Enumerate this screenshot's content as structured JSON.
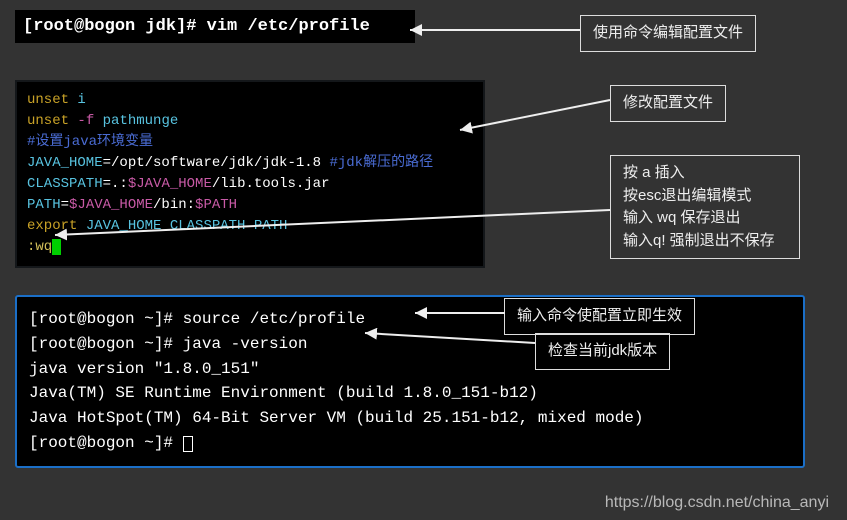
{
  "terminal1": {
    "prompt": "[root@bogon jdk]#",
    "command": "vim /etc/profile"
  },
  "terminal2": {
    "line1a": "unset",
    "line1b": "i",
    "line2a": "unset",
    "line2b": "-f",
    "line2c": "pathmunge",
    "line3a": "#设置java环境变量",
    "line4a": "JAVA_HOME",
    "line4b": "=/opt/software/jdk/jdk-1.8",
    "line4c": "#jdk解压的路径",
    "line5a": "CLASSPATH",
    "line5b": "=.:",
    "line5c": "$JAVA_HOME",
    "line5d": "/lib.tools.jar",
    "line6a": "PATH",
    "line6b": "=",
    "line6c": "$JAVA_HOME",
    "line6d": "/bin:",
    "line6e": "$PATH",
    "line7a": "export",
    "line7b": "JAVA_HOME CLASSPATH PATH",
    "line8a": ":wq"
  },
  "terminal3": {
    "prompt1": "[root@bogon ~]#",
    "cmd1": "source /etc/profile",
    "prompt2": "[root@bogon ~]#",
    "cmd2": "java -version",
    "out1": "java version \"1.8.0_151\"",
    "out2": "Java(TM) SE Runtime Environment (build 1.8.0_151-b12)",
    "out3": "Java HotSpot(TM) 64-Bit Server VM (build 25.151-b12, mixed mode)",
    "prompt3": "[root@bogon ~]#"
  },
  "annotations": {
    "a1": "使用命令编辑配置文件",
    "a2": "修改配置文件",
    "a3_l1": "按 a 插入",
    "a3_l2": "按esc退出编辑模式",
    "a3_l3": "输入 wq 保存退出",
    "a3_l4": "输入q! 强制退出不保存",
    "a4": "输入命令使配置立即生效",
    "a5": "检查当前jdk版本"
  },
  "watermark": "https://blog.csdn.net/china_anyi"
}
